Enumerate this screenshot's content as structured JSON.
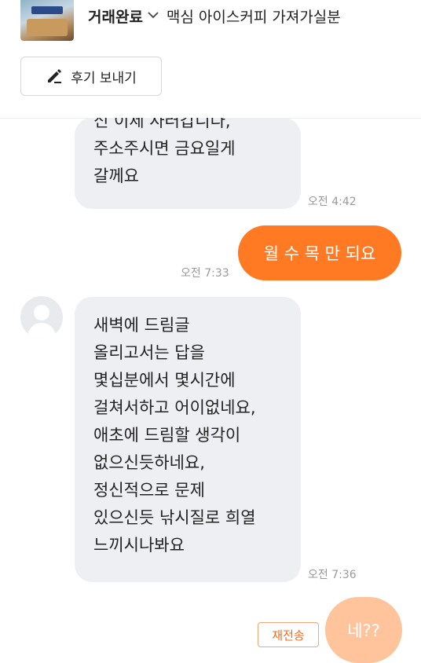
{
  "header": {
    "status": "거래완료",
    "chevron_icon": "chevron-down-icon",
    "title": "맥심 아이스커피 가져가실분",
    "review_button_label": "후기 보내기",
    "review_button_icon": "pencil-icon"
  },
  "messages": [
    {
      "side": "received",
      "lines": [
        "신 이제 사러갑니다,",
        "주소주시면 금요일게",
        "갈께요"
      ],
      "time": "오전 4:42"
    },
    {
      "side": "sent",
      "text": "월 수 목 만 되요",
      "time": "오전 7:33"
    },
    {
      "side": "received",
      "lines": [
        "새벽에 드림글",
        "올리고서는 답을",
        "몇십분에서 몇시간에",
        "걸쳐서하고 어이없네요,",
        "애초에 드림할 생각이",
        "없으신듯하네요,",
        "정신적으로 문제",
        "있으신듯 낚시질로 희열",
        "느끼시나봐요"
      ],
      "time": "오전 7:36"
    },
    {
      "side": "sent",
      "text": "네??",
      "failed": true,
      "resend_label": "재전송"
    }
  ],
  "colors": {
    "accent": "#ff7a22",
    "accent_pending": "#ffc49c",
    "received_bubble": "#eeeff3",
    "time_text": "#9a9a9a"
  }
}
